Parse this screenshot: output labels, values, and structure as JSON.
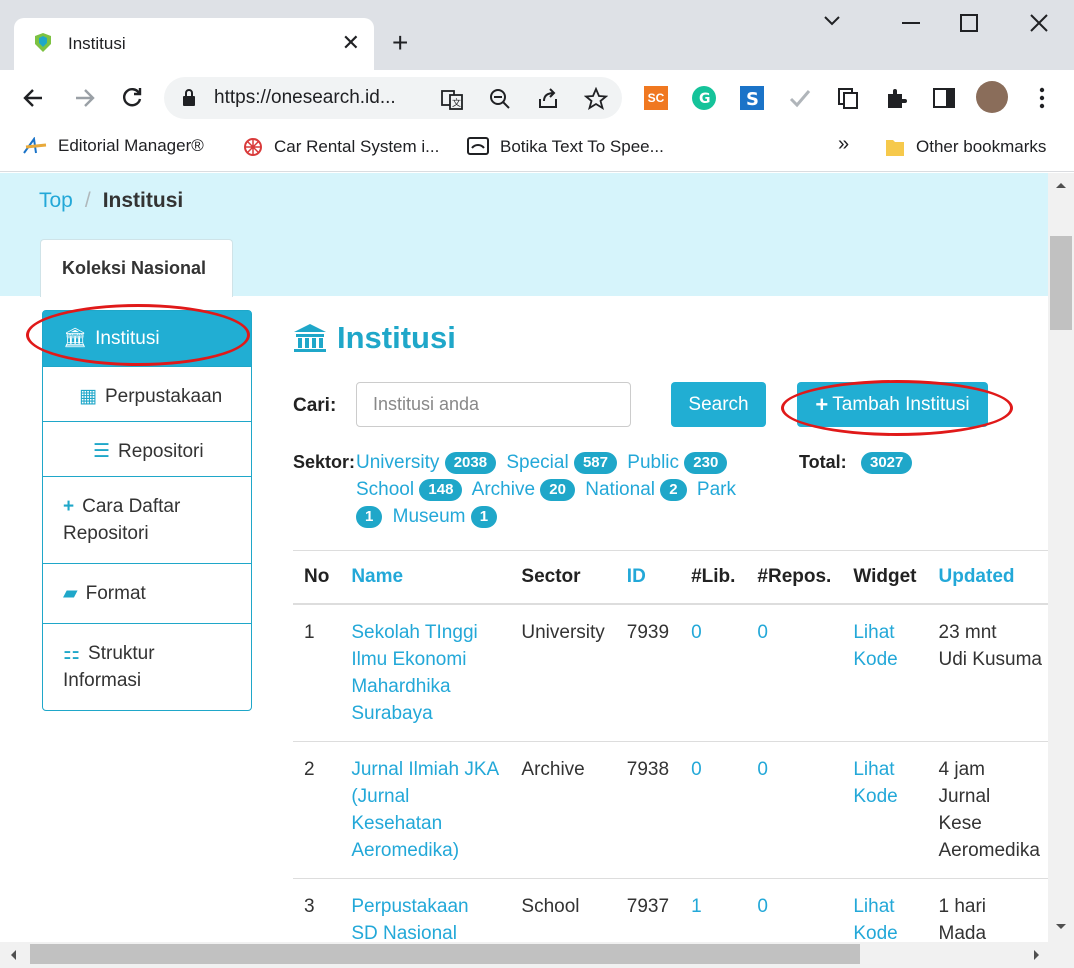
{
  "browser": {
    "tab_title": "Institusi",
    "tab_close": "✕",
    "new_tab": "+",
    "url": "https://onesearch.id...",
    "bookmarks": [
      "Editorial Manager®",
      "Car Rental System i...",
      "Botika Text To Spee...",
      "Other bookmarks"
    ],
    "bookmarks_overflow": "»",
    "ext_sc": "SC"
  },
  "breadcrumb": {
    "top": "Top",
    "sep": "/",
    "current": "Institusi"
  },
  "collection_tab": "Koleksi Nasional",
  "sidebar": {
    "items": [
      {
        "label": "Institusi"
      },
      {
        "label": "Perpustakaan"
      },
      {
        "label": "Repositori"
      },
      {
        "label": "Cara Daftar Repositori"
      },
      {
        "label": "Format"
      },
      {
        "label": "Struktur Informasi"
      }
    ]
  },
  "heading": "Institusi",
  "search": {
    "label": "Cari:",
    "placeholder": "Institusi anda",
    "button": "Search",
    "add_button": "Tambah Institusi"
  },
  "sektor": {
    "label": "Sektor:",
    "items": [
      {
        "name": "University",
        "count": "2038"
      },
      {
        "name": "Special",
        "count": "587"
      },
      {
        "name": "Public",
        "count": "230"
      },
      {
        "name": "School",
        "count": "148"
      },
      {
        "name": "Archive",
        "count": "20"
      },
      {
        "name": "National",
        "count": "2"
      },
      {
        "name": "Park",
        "count": "1"
      },
      {
        "name": "Museum",
        "count": "1"
      }
    ],
    "total_label": "Total:",
    "total": "3027"
  },
  "table": {
    "headers": [
      "No",
      "Name",
      "Sector",
      "ID",
      "#Lib.",
      "#Repos.",
      "Widget",
      "Updated"
    ],
    "rows": [
      {
        "no": "1",
        "name": "Sekolah TInggi Ilmu Ekonomi Mahardhika Surabaya",
        "sector": "University",
        "id": "7939",
        "lib": "0",
        "repos": "0",
        "widget": "Lihat Kode",
        "updated": "23 mnt",
        "updated_by": "Udi Kusuma"
      },
      {
        "no": "2",
        "name": "Jurnal Ilmiah JKA (Jurnal Kesehatan Aeromedika)",
        "sector": "Archive",
        "id": "7938",
        "lib": "0",
        "repos": "0",
        "widget": "Lihat Kode",
        "updated": "4 jam",
        "updated_by": "Jurnal Kese Aeromedika"
      },
      {
        "no": "3",
        "name": "Perpustakaan SD Nasional KPS Balikpapan",
        "sector": "School",
        "id": "7937",
        "lib": "1",
        "repos": "0",
        "widget": "Lihat Kode",
        "updated": "1 hari",
        "updated_by": "Mada"
      }
    ]
  },
  "colors": {
    "accent": "#21aed3",
    "hero_bg": "#d6f4fb",
    "annotation": "#e01919"
  }
}
